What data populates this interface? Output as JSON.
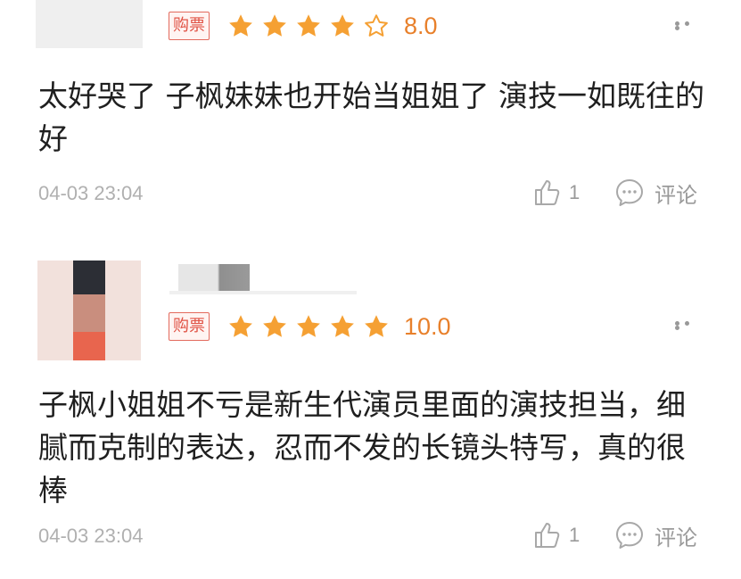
{
  "colors": {
    "star": "#f5a033",
    "score": "#e8802b",
    "badge_border": "#e36a5d",
    "badge_text": "#e05244",
    "meta_text": "#b0b0b0"
  },
  "icons": {
    "star": "star-icon",
    "like": "thumbs-up-icon",
    "comment": "comment-bubble-icon",
    "more": "more-dots-icon"
  },
  "reviews": [
    {
      "badge": "购票",
      "rating_stars": 4.5,
      "score": "8.0",
      "content": "太好哭了 子枫妹妹也开始当姐姐了 演技一如既往的好",
      "time": "04-03 23:04",
      "likes": "1",
      "comment_label": "评论"
    },
    {
      "badge": "购票",
      "rating_stars": 5,
      "score": "10.0",
      "content": "子枫小姐姐不亏是新生代演员里面的演技担当，细腻而克制的表达，忍而不发的长镜头特写，真的很棒",
      "time": "04-03 23:04",
      "likes": "1",
      "comment_label": "评论"
    }
  ]
}
